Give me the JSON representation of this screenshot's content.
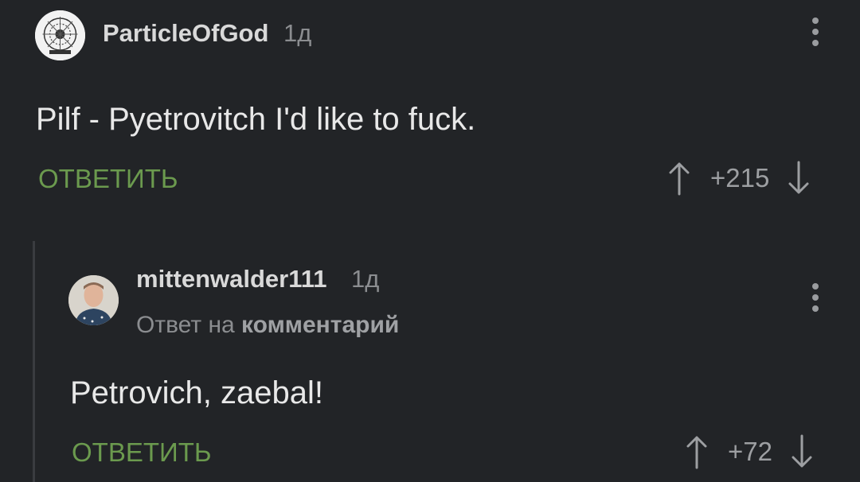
{
  "comments": [
    {
      "username": "ParticleOfGod",
      "time": "1д",
      "avatar_icon": "ornament-avatar-icon",
      "text": "Pilf - Pyetrovitch I'd like to fuck.",
      "reply_label": "ОТВЕТИТЬ",
      "score": "+215"
    },
    {
      "username": "mittenwalder111",
      "time": "1д",
      "avatar_icon": "person-avatar-icon",
      "reply_to_prefix": "Ответ на",
      "reply_to_link": "комментарий",
      "text": "Petrovich, zaebal!",
      "reply_label": "ОТВЕТИТЬ",
      "score": "+72"
    }
  ],
  "colors": {
    "background": "#222427",
    "reply_green": "#6b9a4e",
    "muted": "#8b8d90",
    "thread_line": "#3a3c40"
  }
}
